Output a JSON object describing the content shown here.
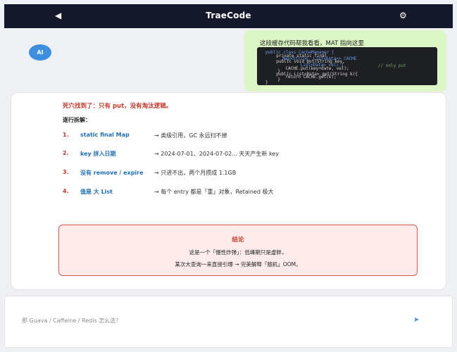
{
  "header": {
    "back_icon": "◀",
    "title": "TraeCode",
    "settings_icon": "⚙"
  },
  "assistant": {
    "avatar_label": "AI"
  },
  "user_message": {
    "text": "这段缓存代码帮我看看，MAT 指向这里",
    "code_lines": [
      "public class CacheManager {",
      "  private static final",
      "    Map<String, List<Data>> CACHE",
      "  public void put(String key,",
      "      List<Data> val) {",
      "    CACHE.put(key+date, val);",
      "  }",
      "  public List<Data> get(String k){",
      "    return CACHE.get(k);",
      "  }",
      "}"
    ],
    "code_comment": "// only put"
  },
  "answer": {
    "headline": "死穴找到了：只有 put，没有淘汰逻辑。",
    "breakdown_title": "逐行拆解：",
    "steps": [
      {
        "num": "1.",
        "term": "static final Map",
        "desc": "→ 类级引用，GC 永远扫不掉"
      },
      {
        "num": "2.",
        "term": "key 拼入日期",
        "desc": "→ 2024-07-01、2024-07-02... 天天产生新 key"
      },
      {
        "num": "3.",
        "term": "没有 remove / expire",
        "desc": "→ 只进不出，两个月攒成 1.1GB"
      },
      {
        "num": "4.",
        "term": "值是 大 List",
        "desc": "→ 每个 entry 都是「重」对象，Retained 极大"
      }
    ],
    "conclusion": {
      "title": "结论",
      "line1": "这是一个「慢性炸弹」：低峰期只是虚胖，",
      "line2": "某次大查询一来直接引爆 → 完美解释「随机」OOM。"
    }
  },
  "composer": {
    "placeholder": "那 Guava / Caffeine / Redis 怎么选？",
    "send_icon": "➤"
  },
  "colors": {
    "header_bg": "#15182b",
    "accent": "#3e8ee0",
    "user_bubble": "#dcf7c5",
    "danger": "#c0392b",
    "term": "#1f6fb2"
  }
}
